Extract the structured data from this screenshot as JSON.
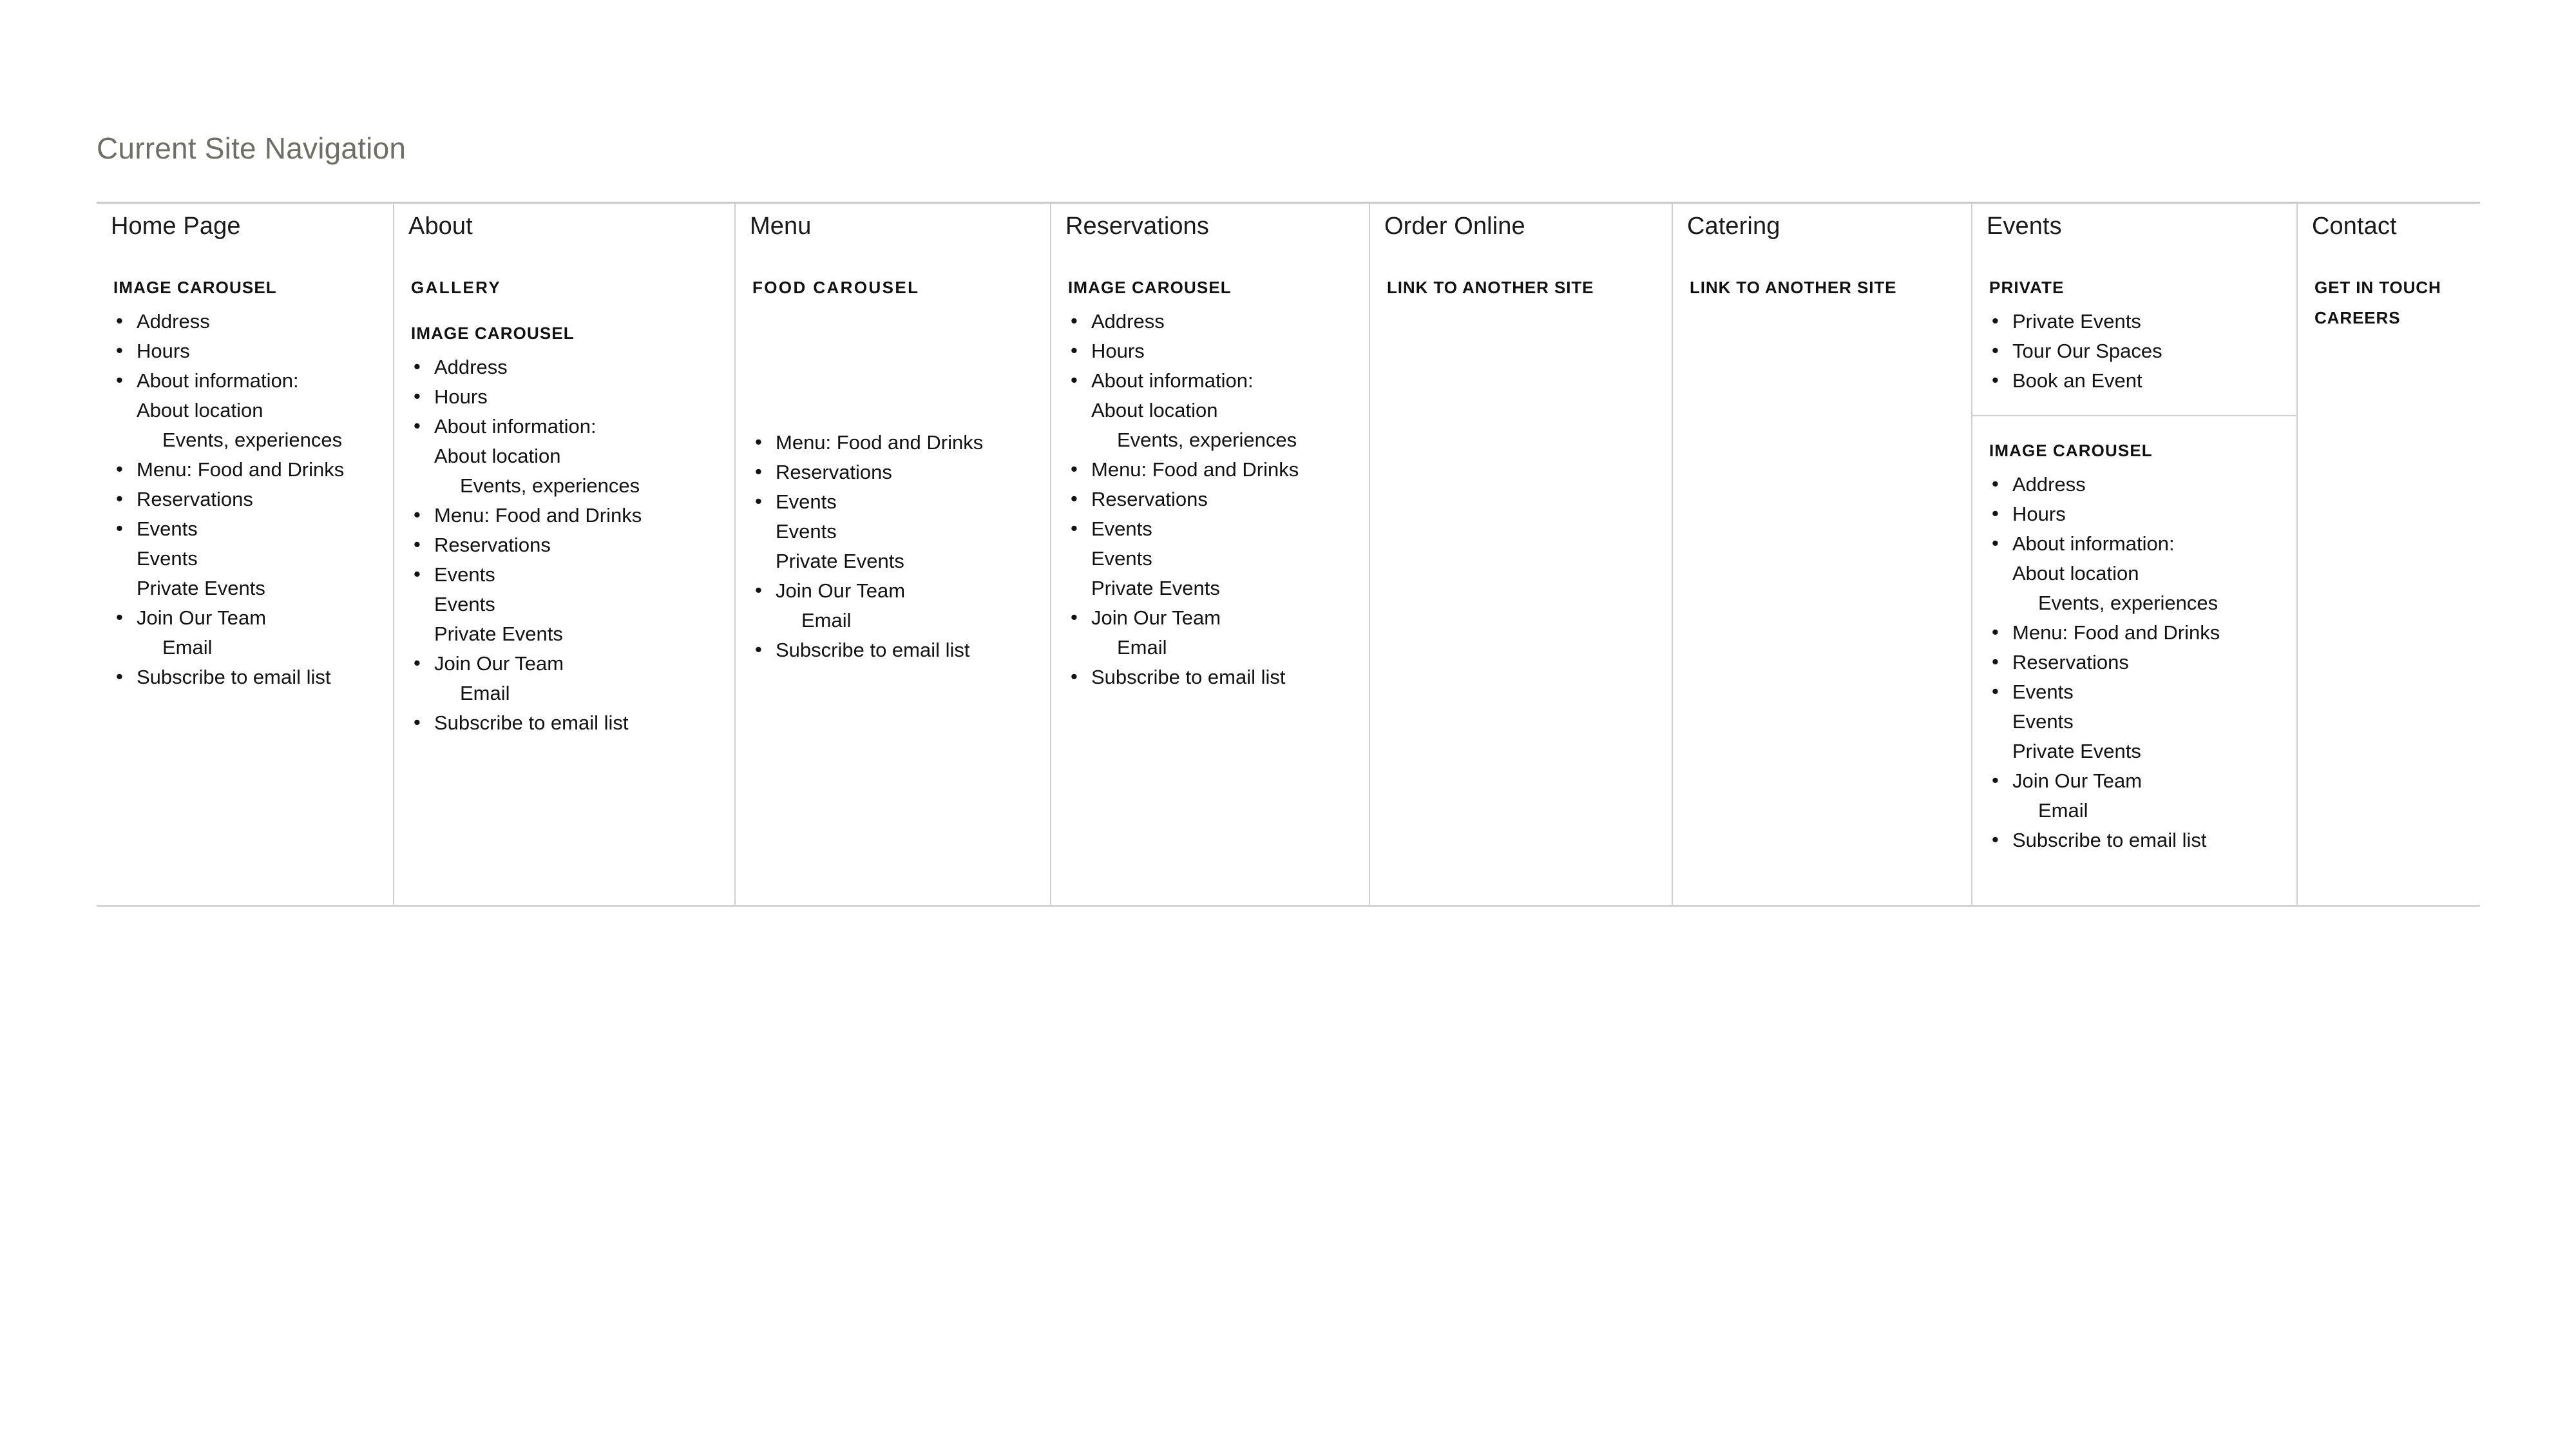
{
  "page": {
    "title": "Current Site Navigation"
  },
  "colors": {
    "title": "#6e6e66",
    "rule": "#cfcfcf",
    "text": "#121212"
  },
  "table": {
    "columns": [
      {
        "header": "Home Page",
        "labels": [
          {
            "text": "IMAGE CAROUSEL",
            "style": "bold"
          }
        ],
        "items": [
          {
            "text": "Address",
            "level": 0
          },
          {
            "text": "Hours",
            "level": 0
          },
          {
            "text": "About information:",
            "level": 0
          },
          {
            "text": "About location",
            "level": 1
          },
          {
            "text": "Events, experiences",
            "level": 2
          },
          {
            "text": "Menu: Food and Drinks",
            "level": 0
          },
          {
            "text": "Reservations",
            "level": 0
          },
          {
            "text": "Events",
            "level": 0
          },
          {
            "text": "Events",
            "level": 1
          },
          {
            "text": "Private Events",
            "level": 1
          },
          {
            "text": "Join Our Team",
            "level": 0
          },
          {
            "text": "Email",
            "level": 2
          },
          {
            "text": "Subscribe to email list",
            "level": 0
          }
        ]
      },
      {
        "header": "About",
        "labels": [
          {
            "text": "GALLERY",
            "style": "bold-loose"
          },
          {
            "text": "IMAGE CAROUSEL",
            "style": "bold"
          }
        ],
        "items": [
          {
            "text": "Address",
            "level": 0
          },
          {
            "text": "Hours",
            "level": 0
          },
          {
            "text": "About information:",
            "level": 0
          },
          {
            "text": "About location",
            "level": 1
          },
          {
            "text": "Events, experiences",
            "level": 2
          },
          {
            "text": "Menu: Food and Drinks",
            "level": 0
          },
          {
            "text": "Reservations",
            "level": 0
          },
          {
            "text": "Events",
            "level": 0
          },
          {
            "text": "Events",
            "level": 1
          },
          {
            "text": "Private Events",
            "level": 1
          },
          {
            "text": "Join Our Team",
            "level": 0
          },
          {
            "text": "Email",
            "level": 2
          },
          {
            "text": "Subscribe to email list",
            "level": 0
          }
        ]
      },
      {
        "header": "Menu",
        "labels": [
          {
            "text": "FOOD CAROUSEL",
            "style": "bold-loose"
          }
        ],
        "items": [
          {
            "text": "Menu: Food and Drinks",
            "level": 0
          },
          {
            "text": "Reservations",
            "level": 0
          },
          {
            "text": "Events",
            "level": 0
          },
          {
            "text": "Events",
            "level": 1
          },
          {
            "text": "Private Events",
            "level": 1
          },
          {
            "text": "Join Our Team",
            "level": 0
          },
          {
            "text": "Email",
            "level": 2
          },
          {
            "text": "Subscribe to email list",
            "level": 0
          }
        ]
      },
      {
        "header": "Reservations",
        "labels": [
          {
            "text": "IMAGE CAROUSEL",
            "style": "bold"
          }
        ],
        "items": [
          {
            "text": "Address",
            "level": 0
          },
          {
            "text": "Hours",
            "level": 0
          },
          {
            "text": "About information:",
            "level": 0
          },
          {
            "text": "About location",
            "level": 1
          },
          {
            "text": "Events, experiences",
            "level": 2
          },
          {
            "text": "Menu: Food and Drinks",
            "level": 0
          },
          {
            "text": "Reservations",
            "level": 0
          },
          {
            "text": "Events",
            "level": 0
          },
          {
            "text": "Events",
            "level": 1
          },
          {
            "text": "Private Events",
            "level": 1
          },
          {
            "text": "Join Our Team",
            "level": 0
          },
          {
            "text": "Email",
            "level": 2
          },
          {
            "text": "Subscribe to email list",
            "level": 0
          }
        ]
      },
      {
        "header": "Order Online",
        "labels": [
          {
            "text": "LINK TO ANOTHER SITE",
            "style": "plain"
          }
        ],
        "items": []
      },
      {
        "header": "Catering",
        "labels": [
          {
            "text": "LINK TO ANOTHER SITE",
            "style": "plain"
          }
        ],
        "items": []
      },
      {
        "header": "Events",
        "boxes": [
          {
            "label": "PRIVATE",
            "items": [
              {
                "text": "Private Events",
                "level": 0
              },
              {
                "text": "Tour Our Spaces",
                "level": 0
              },
              {
                "text": "Book an Event",
                "level": 0
              }
            ]
          },
          {
            "label": "IMAGE CAROUSEL",
            "items": [
              {
                "text": "Address",
                "level": 0
              },
              {
                "text": "Hours",
                "level": 0
              },
              {
                "text": "About information:",
                "level": 0
              },
              {
                "text": "About location",
                "level": 1
              },
              {
                "text": "Events, experiences",
                "level": 2
              },
              {
                "text": "Menu: Food and Drinks",
                "level": 0
              },
              {
                "text": "Reservations",
                "level": 0
              },
              {
                "text": "Events",
                "level": 0
              },
              {
                "text": "Events",
                "level": 1
              },
              {
                "text": "Private Events",
                "level": 1
              },
              {
                "text": "Join Our Team",
                "level": 0
              },
              {
                "text": "Email",
                "level": 2
              },
              {
                "text": "Subscribe to email list",
                "level": 0
              }
            ]
          }
        ]
      },
      {
        "header": "Contact",
        "labels": [
          {
            "text": "GET IN TOUCH",
            "style": "plain"
          },
          {
            "text": "CAREERS",
            "style": "plain"
          }
        ],
        "items": []
      }
    ]
  }
}
